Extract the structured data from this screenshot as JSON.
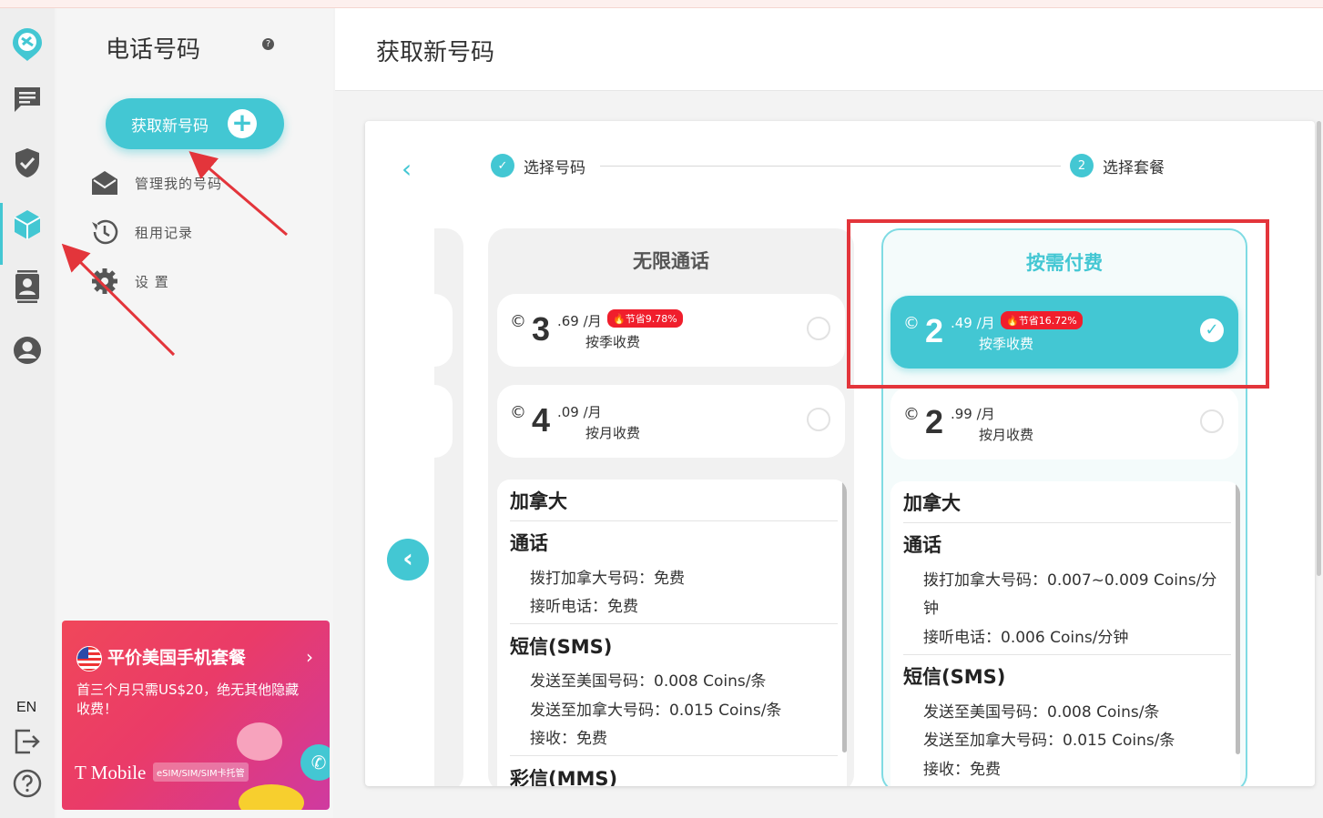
{
  "sidebar": {
    "title": "电话号码",
    "help": "?",
    "get_button": "获取新号码",
    "menu": [
      {
        "label": "管理我的号码",
        "icon": "envelope-open-icon"
      },
      {
        "label": "租用记录",
        "icon": "history-icon"
      },
      {
        "label": "设 置",
        "icon": "gear-icon"
      }
    ],
    "promo": {
      "title": "平价美国手机套餐",
      "desc": "首三个月只需US$20，绝无其他隐藏收费！",
      "brand": "T Mobile",
      "tag": "eSIM/SIM/SIM卡托管"
    }
  },
  "rail": {
    "language": "EN",
    "icons": [
      "logo-icon",
      "messages-icon",
      "shield-check-icon",
      "cube-icon",
      "contacts-icon",
      "account-icon",
      "logout-icon",
      "help-icon"
    ]
  },
  "header": {
    "title": "获取新号码"
  },
  "stepper": {
    "step1": "选择号码",
    "step2_num": "2",
    "step2": "选择套餐"
  },
  "plans": [
    {
      "title": "无限通话",
      "options": [
        {
          "coin": "©",
          "int": "3",
          "dec": ".69 /月",
          "sub": "按季收费",
          "save": "节省9.78%",
          "selected": false
        },
        {
          "coin": "©",
          "int": "4",
          "dec": ".09 /月",
          "sub": "按月收费",
          "save": "",
          "selected": false
        }
      ],
      "details": {
        "country": "加拿大",
        "call_title": "通话",
        "call_rows": [
          "拨打加拿大号码：免费",
          "接听电话：免费"
        ],
        "sms_title": "短信(SMS)",
        "sms_rows": [
          "发送至美国号码：0.008 Coins/条",
          "发送至加拿大号码：0.015 Coins/条",
          "接收：免费"
        ],
        "mms_title": "彩信(MMS)"
      }
    },
    {
      "title": "按需付费",
      "options": [
        {
          "coin": "©",
          "int": "2",
          "dec": ".49 /月",
          "sub": "按季收费",
          "save": "节省16.72%",
          "selected": true
        },
        {
          "coin": "©",
          "int": "2",
          "dec": ".99 /月",
          "sub": "按月收费",
          "save": "",
          "selected": false
        }
      ],
      "details": {
        "country": "加拿大",
        "call_title": "通话",
        "call_rows": [
          "拨打加拿大号码：0.007~0.009 Coins/分",
          "钟",
          "接听电话：0.006 Coins/分钟"
        ],
        "sms_title": "短信(SMS)",
        "sms_rows": [
          "发送至美国号码：0.008 Coins/条",
          "发送至加拿大号码：0.015 Coins/条",
          "接收：免费"
        ]
      }
    }
  ],
  "colors": {
    "accent": "#43c7d3",
    "annotation_red": "#e3353b",
    "save_badge": "#f01e2c"
  }
}
